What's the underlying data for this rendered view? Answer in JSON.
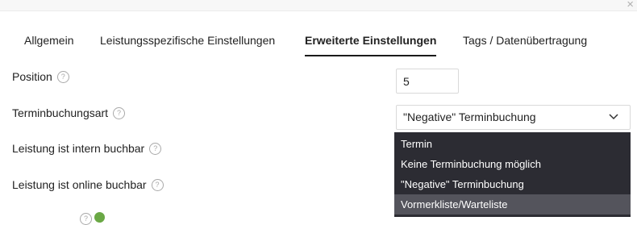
{
  "window": {
    "close_glyph": "×"
  },
  "tabs": [
    {
      "label": "Allgemein",
      "active": false
    },
    {
      "label": "Leistungsspezifische Einstellungen",
      "active": false
    },
    {
      "label": "Erweiterte Einstellungen",
      "active": true
    },
    {
      "label": "Tags / Datenübertragung",
      "active": false
    }
  ],
  "fields": {
    "position": {
      "label": "Position",
      "value": "5"
    },
    "terminbuchungsart": {
      "label": "Terminbuchungsart",
      "value": "\"Negative\" Terminbuchung"
    },
    "intern": {
      "label": "Leistung ist intern buchbar"
    },
    "online": {
      "label": "Leistung ist online buchbar"
    }
  },
  "help_glyph": "?",
  "dropdown": {
    "options": [
      "Termin",
      "Keine Terminbuchung möglich",
      "\"Negative\" Terminbuchung",
      "Vormerkliste/Warteliste"
    ],
    "highlighted": "Vormerkliste/Warteliste"
  },
  "colors": {
    "dropdown_bg": "#2c2c33",
    "dropdown_highlight": "#54545c",
    "accent_green": "#6aa845"
  }
}
